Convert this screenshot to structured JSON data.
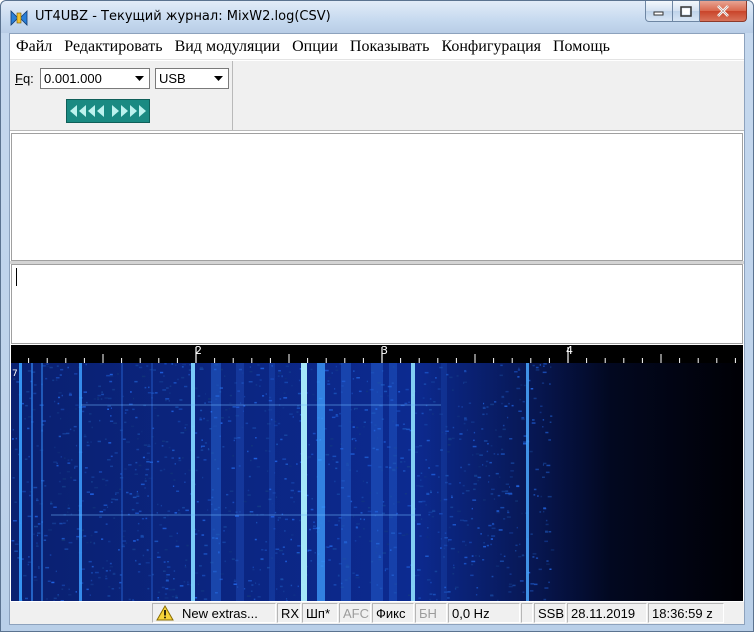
{
  "window": {
    "title": "UT4UBZ - Текущий журнал: MixW2.log(CSV)"
  },
  "menu": [
    "Файл",
    "Редактировать",
    "Вид модуляции",
    "Опции",
    "Показывать",
    "Конфигурация",
    "Помощь"
  ],
  "toolbar": {
    "fq_label": "Fq:",
    "fq_mnemonic": "F",
    "fq_rest": "q:",
    "frequency_value": "0.001.000",
    "mode_value": "USB",
    "tune_icon": "double-arrow-tune-icon"
  },
  "waterfall": {
    "scale_labels": [
      "2",
      "3",
      "4"
    ],
    "left_marker": "7"
  },
  "status": {
    "message": "New extras...",
    "rx": "RX",
    "sp": "Шп*",
    "afc": "AFC",
    "fix": "Фикс",
    "bn": "БН",
    "offset": "0,0 Hz",
    "mode": "SSB",
    "date": "28.11.2019",
    "time": "18:36:59 z"
  },
  "colors": {
    "tune_button": "#1a8a82",
    "waterfall_bg": "#000000",
    "signal": "#29a8ff"
  }
}
